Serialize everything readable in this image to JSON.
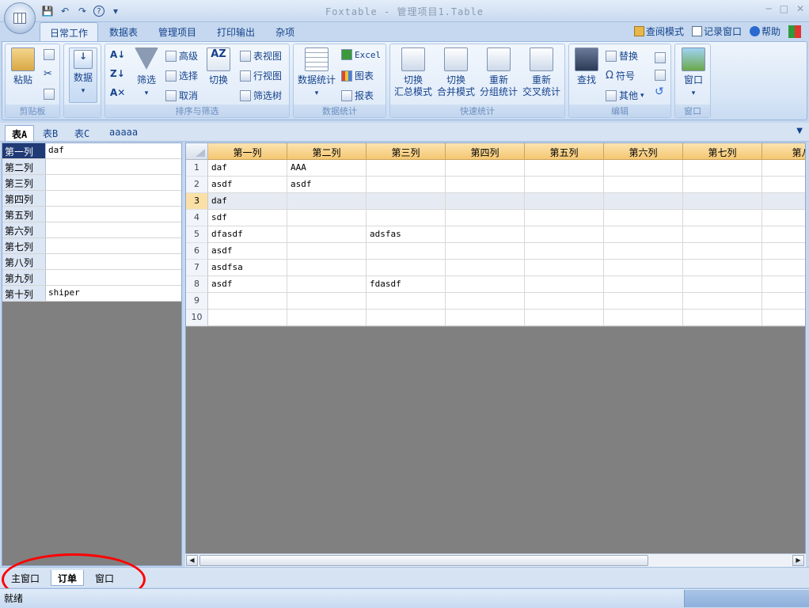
{
  "app": {
    "title": "Foxtable - 管理项目1.Table"
  },
  "qat": {
    "save": "💾",
    "undo": "↶",
    "redo": "↷",
    "help": "?",
    "more": "▾"
  },
  "window_controls": {
    "minimize": "─",
    "restore": "□",
    "close": "✕"
  },
  "ribbon_tabs": [
    "日常工作",
    "数据表",
    "管理项目",
    "打印输出",
    "杂项"
  ],
  "right_tools": {
    "view_mode": "查阅模式",
    "record_window": "记录窗口",
    "help": "帮助"
  },
  "groups": {
    "clipboard": {
      "label": "剪贴板",
      "paste": "粘贴"
    },
    "data": {
      "label": "",
      "data": "数据",
      "arrow": "▾"
    },
    "sort": {
      "label": "排序与筛选",
      "filter": "筛选",
      "advanced": "高级",
      "select": "选择",
      "cancel": "取消",
      "toggle": "切换",
      "table_view": "表视图",
      "row_view": "行视图",
      "filter_tree": "筛选树"
    },
    "stats": {
      "label": "数据统计",
      "data_stats": "数据统计",
      "excel": "Excel",
      "chart": "图表",
      "report": "报表"
    },
    "quick": {
      "label": "快速统计",
      "b1a": "切换",
      "b1b": "汇总模式",
      "b2a": "切换",
      "b2b": "合并模式",
      "b3a": "重新",
      "b3b": "分组统计",
      "b4a": "重新",
      "b4b": "交叉统计"
    },
    "edit": {
      "label": "编辑",
      "find": "查找",
      "replace": "替换",
      "symbol": "符号",
      "other": "其他"
    },
    "window": {
      "label": "窗口",
      "window": "窗口"
    }
  },
  "sheet_tabs": [
    "表A",
    "表B",
    "表C",
    "aaaaa"
  ],
  "left_panel": [
    {
      "label": "第一列",
      "value": "daf"
    },
    {
      "label": "第二列",
      "value": ""
    },
    {
      "label": "第三列",
      "value": ""
    },
    {
      "label": "第四列",
      "value": ""
    },
    {
      "label": "第五列",
      "value": ""
    },
    {
      "label": "第六列",
      "value": ""
    },
    {
      "label": "第七列",
      "value": ""
    },
    {
      "label": "第八列",
      "value": ""
    },
    {
      "label": "第九列",
      "value": ""
    },
    {
      "label": "第十列",
      "value": "shiper"
    }
  ],
  "grid": {
    "columns": [
      "第一列",
      "第二列",
      "第三列",
      "第四列",
      "第五列",
      "第六列",
      "第七列",
      "第八"
    ],
    "row_numbers": [
      "1",
      "2",
      "3",
      "4",
      "5",
      "6",
      "7",
      "8",
      "9",
      "10"
    ],
    "rows": [
      [
        "daf",
        "AAA",
        "",
        "",
        "",
        "",
        "",
        ""
      ],
      [
        "asdf",
        "asdf",
        "",
        "",
        "",
        "",
        "",
        ""
      ],
      [
        "daf",
        "",
        "",
        "",
        "",
        "",
        "",
        ""
      ],
      [
        "sdf",
        "",
        "",
        "",
        "",
        "",
        "",
        ""
      ],
      [
        "dfasdf",
        "",
        "adsfas",
        "",
        "",
        "",
        "",
        ""
      ],
      [
        "asdf",
        "",
        "",
        "",
        "",
        "",
        "",
        ""
      ],
      [
        "asdfsa",
        "",
        "",
        "",
        "",
        "",
        "",
        ""
      ],
      [
        "asdf",
        "",
        "fdasdf",
        "",
        "",
        "",
        "",
        ""
      ],
      [
        "",
        "",
        "",
        "",
        "",
        "",
        "",
        ""
      ],
      [
        "",
        "",
        "",
        "",
        "",
        "",
        "",
        ""
      ]
    ],
    "current_row": 3
  },
  "window_tabs": [
    "主窗口",
    "订单",
    "窗口"
  ],
  "status": {
    "text": "就绪"
  },
  "scroll": {
    "left": "◀",
    "right": "▶",
    "dropdown": "▼"
  }
}
